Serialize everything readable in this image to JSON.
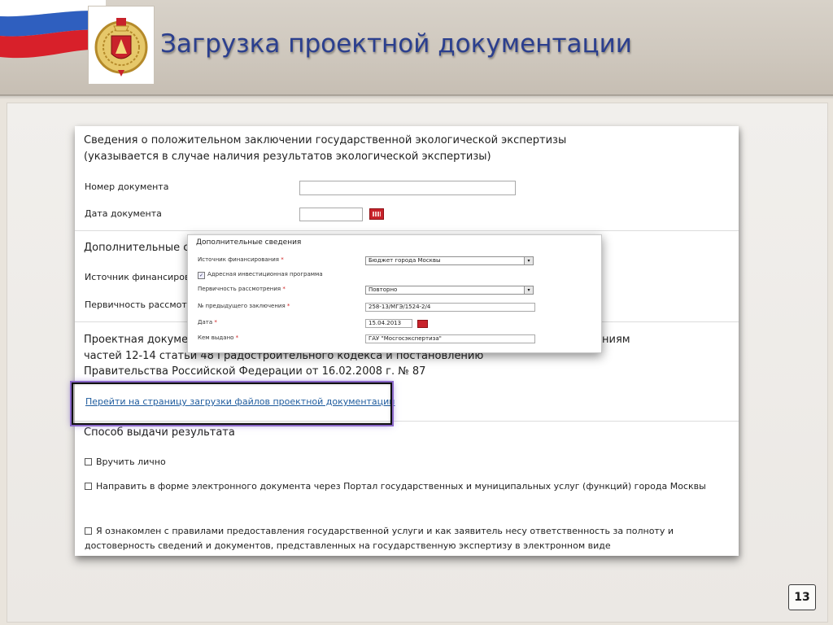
{
  "slide": {
    "title": "Загрузка проектной документации",
    "page_number": "13"
  },
  "form": {
    "eco_section_title_line1": "Сведения о положительном заключении государственной экологической экспертизы",
    "eco_section_title_line2": "(указывается в случае наличия результатов экологической экспертизы)",
    "doc_number_label": "Номер документа",
    "doc_number_value": "",
    "doc_date_label": "Дата документа",
    "doc_date_value": "",
    "additional_title_partial": "Дополнительные с",
    "funding_source_label_partial": "Источник финансирова",
    "review_priority_label_partial": "Первичность рассмотр",
    "project_docs_line1_left": "Проектная докуме",
    "project_docs_line1_right": "ниям",
    "project_docs_line2": "частей 12-14 статьи 48 Градостроительного кодекса и постановлению",
    "project_docs_line3": "Правительства Российской Федерации от 16.02.2008 г. № 87",
    "upload_link": "Перейти на страницу загрузки файлов проектной документации",
    "result_method_title": "Способ выдачи результата",
    "deliver_personally": "Вручить лично",
    "send_electronic": "Направить в форме электронного документа через Портал государственных и муниципальных услуг (функций) города Москвы",
    "agreement_text": "Я ознакомлен с правилами предоставления государственной услуги и как заявитель несу ответственность за полноту и достоверность сведений и документов, представленных на государственную экспертизу в электронном виде"
  },
  "popup": {
    "title": "Дополнительные сведения",
    "funding_source_label": "Источник финансирования",
    "funding_source_value": "Бюджет города Москвы",
    "address_program_label": "Адресная инвестиционная программа",
    "address_program_checked": true,
    "review_priority_label": "Первичность рассмотрения",
    "review_priority_value": "Повторно",
    "prev_conclusion_label": "№ предыдущего заключения",
    "prev_conclusion_value": "258-13/МГЭ/1524-2/4",
    "date_label": "Дата",
    "date_value": "15.04.2013",
    "issued_by_label": "Кем выдано",
    "issued_by_value": "ГАУ \"Мосгосэкспертиза\"",
    "required_mark": "*"
  },
  "colors": {
    "title_blue": "#2b3f8e",
    "link_blue": "#1f5c9e",
    "calendar_red": "#c8222b",
    "highlight_purple": "#8a67c9"
  },
  "icons": {
    "flag": "russian-flag-icon",
    "coat_of_arms": "coat-of-arms-icon",
    "calendar": "calendar-icon",
    "dropdown": "chevron-down-icon",
    "checkbox": "checkbox-icon"
  }
}
